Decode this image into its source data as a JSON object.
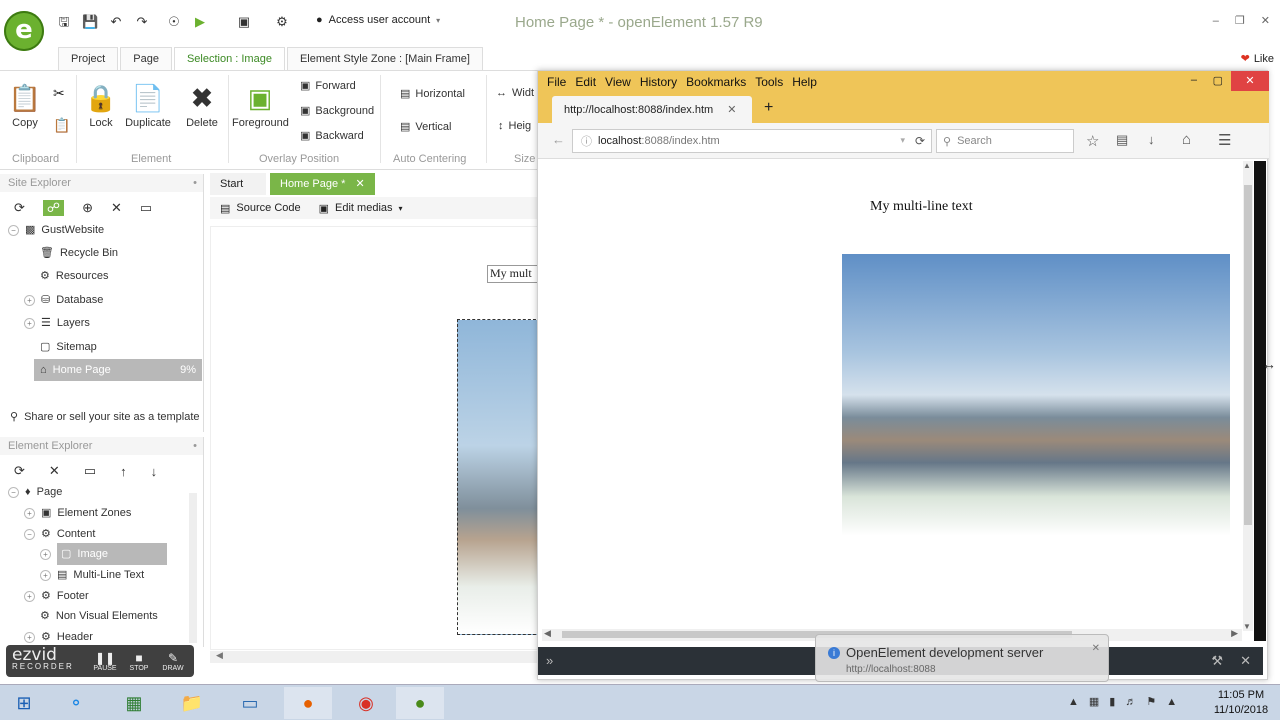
{
  "app": {
    "title": "Home Page * - openElement 1.57 R9",
    "logo_letter": "e",
    "user_account": "Access user account"
  },
  "ribbon_tabs": [
    "Project",
    "Page",
    "Selection : Image",
    "Element Style Zone : [Main Frame]"
  ],
  "like_label": "Like",
  "ribbon": {
    "copy": "Copy",
    "lock": "Lock",
    "duplicate": "Duplicate",
    "delete": "Delete",
    "foreground": "Foreground",
    "forward": "Forward",
    "background": "Background",
    "backward": "Backward",
    "horizontal": "Horizontal",
    "vertical": "Vertical",
    "width": "Widt",
    "height": "Heig",
    "groups": [
      "Clipboard",
      "Element",
      "Overlay Position",
      "Auto Centering",
      "Size"
    ]
  },
  "site_explorer": {
    "title": "Site Explorer",
    "root": "GustWebsite",
    "items": [
      "Recycle Bin",
      "Resources",
      "Database",
      "Layers",
      "Sitemap",
      "Home Page"
    ],
    "home_percent": "9%",
    "share": "Share or sell your site as a template"
  },
  "element_explorer": {
    "title": "Element Explorer",
    "items": [
      "Page",
      "Element Zones",
      "Content",
      "Image",
      "Multi-Line Text",
      "Footer",
      "Non Visual Elements",
      "Header"
    ]
  },
  "editor": {
    "tabs": [
      "Start",
      "Home Page *"
    ],
    "source_code": "Source Code",
    "edit_medias": "Edit medias",
    "preview_text": "My mult"
  },
  "browser": {
    "menu": [
      "File",
      "Edit",
      "View",
      "History",
      "Bookmarks",
      "Tools",
      "Help"
    ],
    "tab_title": "http://localhost:8088/index.htm",
    "url_host": "localhost",
    "url_rest": ":8088/index.htm",
    "search_placeholder": "Search",
    "page_text": "My multi-line text"
  },
  "notification": {
    "title": "OpenElement development server",
    "url": "http://localhost:8088"
  },
  "ezvid": {
    "brand": "ezvid",
    "sub": "RECORDER",
    "pause": "PAUSE",
    "stop": "STOP",
    "draw": "DRAW"
  },
  "taskbar": {
    "time": "11:05 PM",
    "date": "11/10/2018"
  }
}
